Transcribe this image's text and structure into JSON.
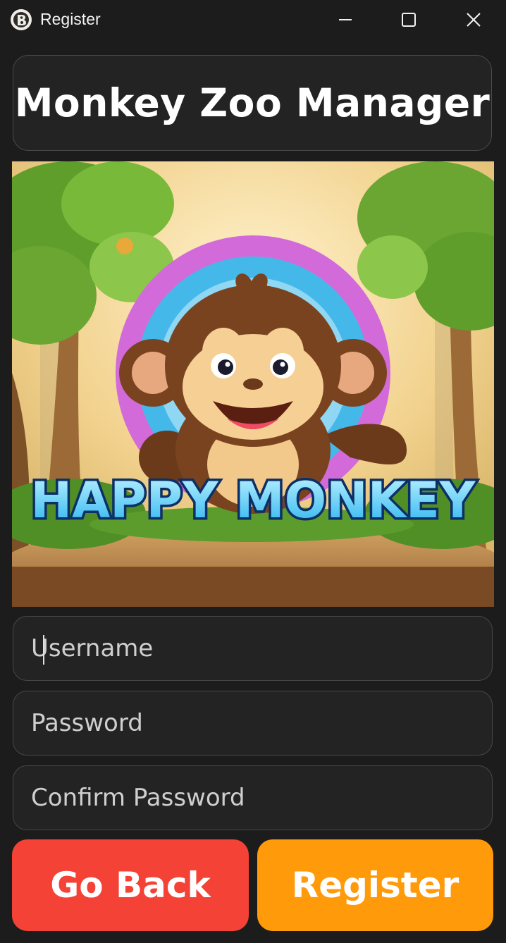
{
  "window": {
    "title": "Register",
    "controls": [
      "minimize-icon",
      "maximize-icon",
      "close-icon"
    ]
  },
  "header": {
    "app_title": "Monkey Zoo Manager"
  },
  "hero": {
    "logo_text": "HAPPY MONKEY",
    "icon": "monkey-mascot-illustration"
  },
  "form": {
    "username": {
      "placeholder": "Username",
      "value": ""
    },
    "password": {
      "placeholder": "Password",
      "value": ""
    },
    "confirm_password": {
      "placeholder": "Confirm Password",
      "value": ""
    }
  },
  "buttons": {
    "back_label": "Go Back",
    "register_label": "Register"
  },
  "colors": {
    "background": "#1c1c1c",
    "card": "#232323",
    "back_button": "#f44336",
    "register_button": "#ff9a0a"
  }
}
